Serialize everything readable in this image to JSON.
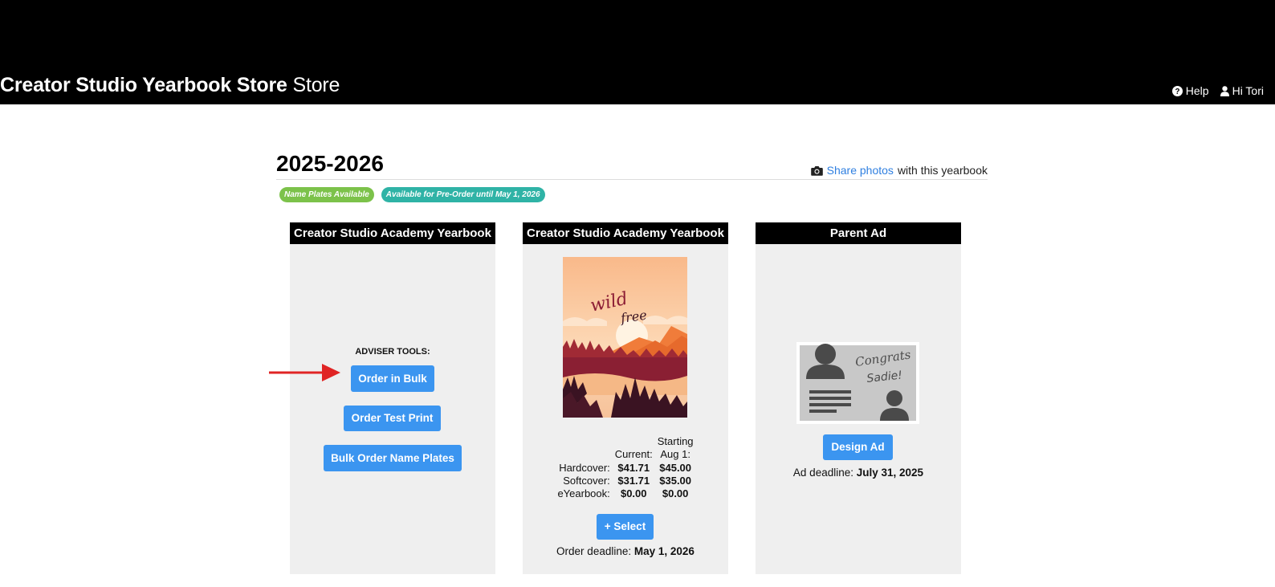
{
  "header": {
    "brand_bold": "Creator Studio Yearbook Store",
    "brand_suffix": "Store",
    "help_label": "Help",
    "user_label": "Hi Tori"
  },
  "year": {
    "title": "2025-2026",
    "share_link": "Share photos",
    "share_rest": "with this yearbook"
  },
  "badges": [
    {
      "label": "Name Plates Available",
      "color": "#7cc24a"
    },
    {
      "label": "Available for Pre-Order until May 1, 2026",
      "color": "#2fb3a6"
    }
  ],
  "cards": {
    "adviser": {
      "title": "Creator Studio Academy Yearbook",
      "section_label": "ADVISER TOOLS:",
      "buttons": [
        "Order in Bulk",
        "Order Test Print",
        "Bulk Order Name Plates"
      ]
    },
    "yearbook": {
      "title": "Creator Studio Academy Yearbook",
      "cover_text_1": "wild",
      "cover_text_2": "free",
      "col_current": "Current:",
      "col_starting_1": "Starting",
      "col_starting_2": "Aug 1:",
      "rows": [
        {
          "label": "Hardcover:",
          "current": "$41.71",
          "starting": "$45.00"
        },
        {
          "label": "Softcover:",
          "current": "$31.71",
          "starting": "$35.00"
        },
        {
          "label": "eYearbook:",
          "current": "$0.00",
          "starting": "$0.00"
        }
      ],
      "select_label": "+ Select",
      "deadline_label": "Order deadline:",
      "deadline_value": "May 1, 2026"
    },
    "parent_ad": {
      "title": "Parent Ad",
      "ad_text_1": "Congrats",
      "ad_text_2": "Sadie!",
      "button_label": "Design Ad",
      "deadline_label": "Ad deadline:",
      "deadline_value": "July 31, 2025"
    }
  },
  "colors": {
    "accent": "#3b95f0",
    "link": "#2f7fe0",
    "header_bg": "#000000",
    "card_bg": "#efefef",
    "arrow": "#e02424"
  },
  "icons": [
    "question-circle-icon",
    "user-icon",
    "camera-icon",
    "arrow-right-icon"
  ]
}
